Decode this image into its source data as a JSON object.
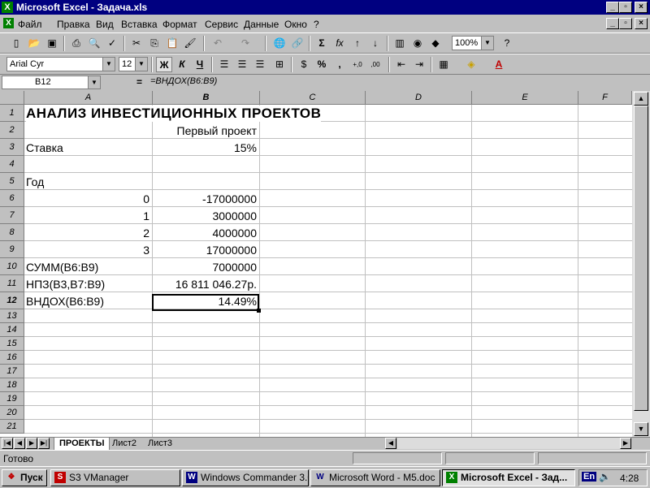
{
  "window": {
    "title": "Microsoft Excel - Задача.xls",
    "app_icon": "excel-icon"
  },
  "menu": [
    "Файл",
    "Правка",
    "Вид",
    "Вставка",
    "Формат",
    "Сервис",
    "Данные",
    "Окно",
    "?"
  ],
  "toolbar": {
    "zoom": "100%",
    "font_name": "Arial Cyr",
    "font_size": "12",
    "bold": "Ж",
    "italic": "К",
    "underline": "Ч",
    "sum": "Σ",
    "fx": "fx",
    "percent": "%",
    "comma": ",",
    "inc_dec": "+,0",
    "dec_dec": ",00"
  },
  "formula_bar": {
    "cell_ref": "B12",
    "equals": "=",
    "formula": "=ВНДОХ(B6:B9)"
  },
  "columns": [
    "A",
    "B",
    "C",
    "D",
    "E",
    "F"
  ],
  "rows": [
    "1",
    "2",
    "3",
    "4",
    "5",
    "6",
    "7",
    "8",
    "9",
    "10",
    "11",
    "12",
    "13",
    "14",
    "15",
    "16",
    "17",
    "18",
    "19",
    "20",
    "21"
  ],
  "cells": {
    "A1": "АНАЛИЗ  ИНВЕСТИЦИОННЫХ  ПРОЕКТОВ",
    "B2": "Первый проект",
    "A3": "Ставка",
    "B3": "15%",
    "A5": "Год",
    "A6": "0",
    "B6": "-17000000",
    "A7": "1",
    "B7": "3000000",
    "A8": "2",
    "B8": "4000000",
    "A9": "3",
    "B9": "17000000",
    "A10": "СУММ(B6:B9)",
    "B10": "7000000",
    "A11": "НПЗ(B3,B7:B9)",
    "B11": "16 811 046.27р.",
    "A12": "ВНДОХ(B6:B9)",
    "B12": "14.49%"
  },
  "sheet_tabs": [
    "ПРОЕКТЫ",
    "Лист2",
    "Лист3"
  ],
  "active_tab": "ПРОЕКТЫ",
  "status": "Готово",
  "taskbar": {
    "start": "Пуск",
    "tasks": [
      "S3 VManager",
      "Windows Commander 3.0...",
      "Microsoft Word - M5.doc",
      "Microsoft Excel - Зад..."
    ],
    "lang": "En",
    "clock": "4:28"
  },
  "colors": {
    "title_bg": "#000080",
    "face": "#c0c0c0",
    "grid": "#c0c0c0"
  }
}
